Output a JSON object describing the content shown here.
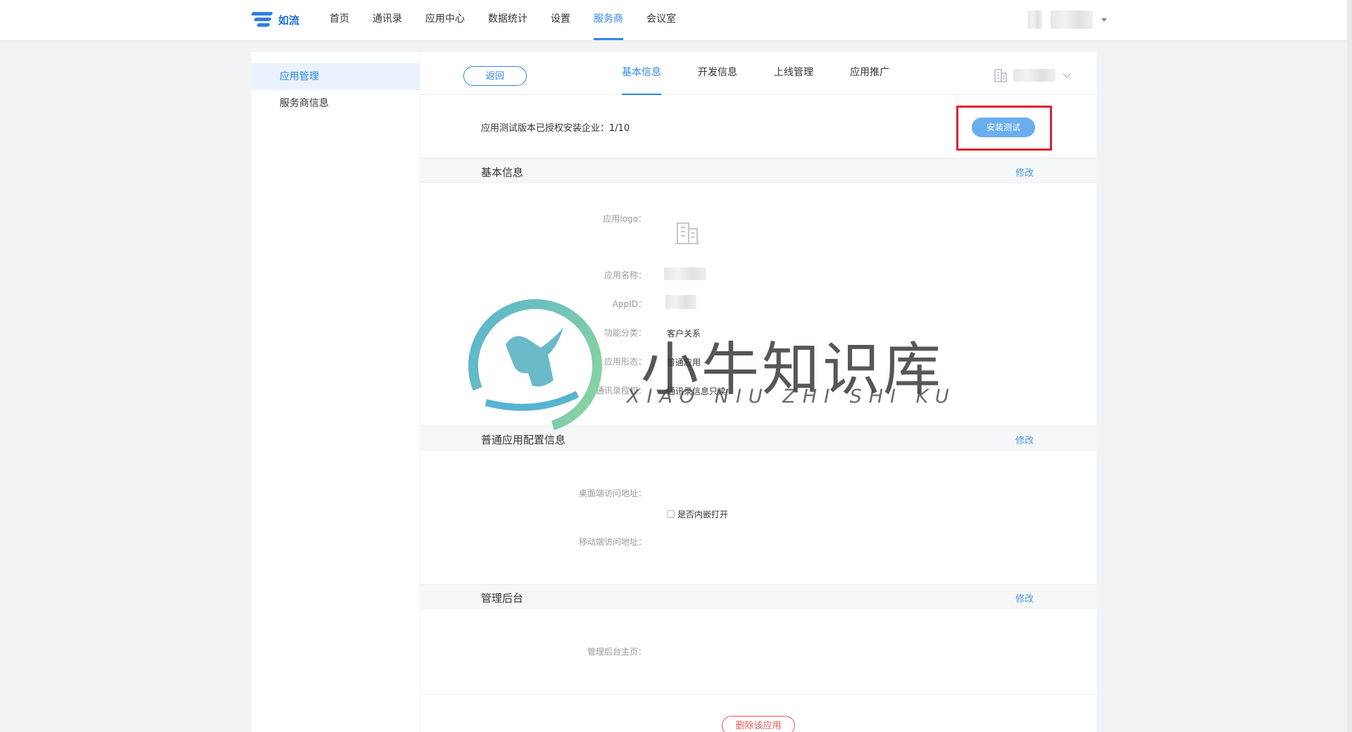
{
  "header": {
    "logo_text": "如流",
    "nav": [
      {
        "label": "首页"
      },
      {
        "label": "通讯录"
      },
      {
        "label": "应用中心"
      },
      {
        "label": "数据统计"
      },
      {
        "label": "设置"
      },
      {
        "label": "服务商"
      },
      {
        "label": "会议室"
      }
    ],
    "active_nav": "服务商"
  },
  "sidebar": {
    "items": [
      {
        "label": "应用管理"
      },
      {
        "label": "服务商信息"
      }
    ]
  },
  "main": {
    "back_label": "返回",
    "tabs": [
      {
        "label": "基本信息"
      },
      {
        "label": "开发信息"
      },
      {
        "label": "上线管理"
      },
      {
        "label": "应用推广"
      }
    ],
    "test_text": "应用测试版本已授权安装企业：1/10",
    "install_test_label": "安装测试",
    "basic": {
      "title": "基本信息",
      "edit": "修改",
      "logo_label": "应用logo：",
      "name_label": "应用名称：",
      "appid_label": "AppID：",
      "category_label": "功能分类：",
      "category_value": "客户关系",
      "form_label": "应用形态：",
      "form_value": "普通应用",
      "contacts_label": "通讯录授权：",
      "contacts_value": "通讯录信息只读"
    },
    "config": {
      "title": "普通应用配置信息",
      "edit": "修改",
      "desktop_label": "桌面端访问地址：",
      "embed_label": "是否内嵌打开",
      "mobile_label": "移动端访问地址："
    },
    "admin": {
      "title": "管理后台",
      "edit": "修改",
      "home_label": "管理后台主页："
    },
    "delete_label": "删除该应用"
  },
  "watermark": {
    "text": "小牛知识库",
    "sub": "XIAO NIU ZHI SHI KU"
  },
  "colors": {
    "accent": "#2f87e6",
    "danger": "#e85a5a",
    "highlight_box": "#e0222e"
  }
}
